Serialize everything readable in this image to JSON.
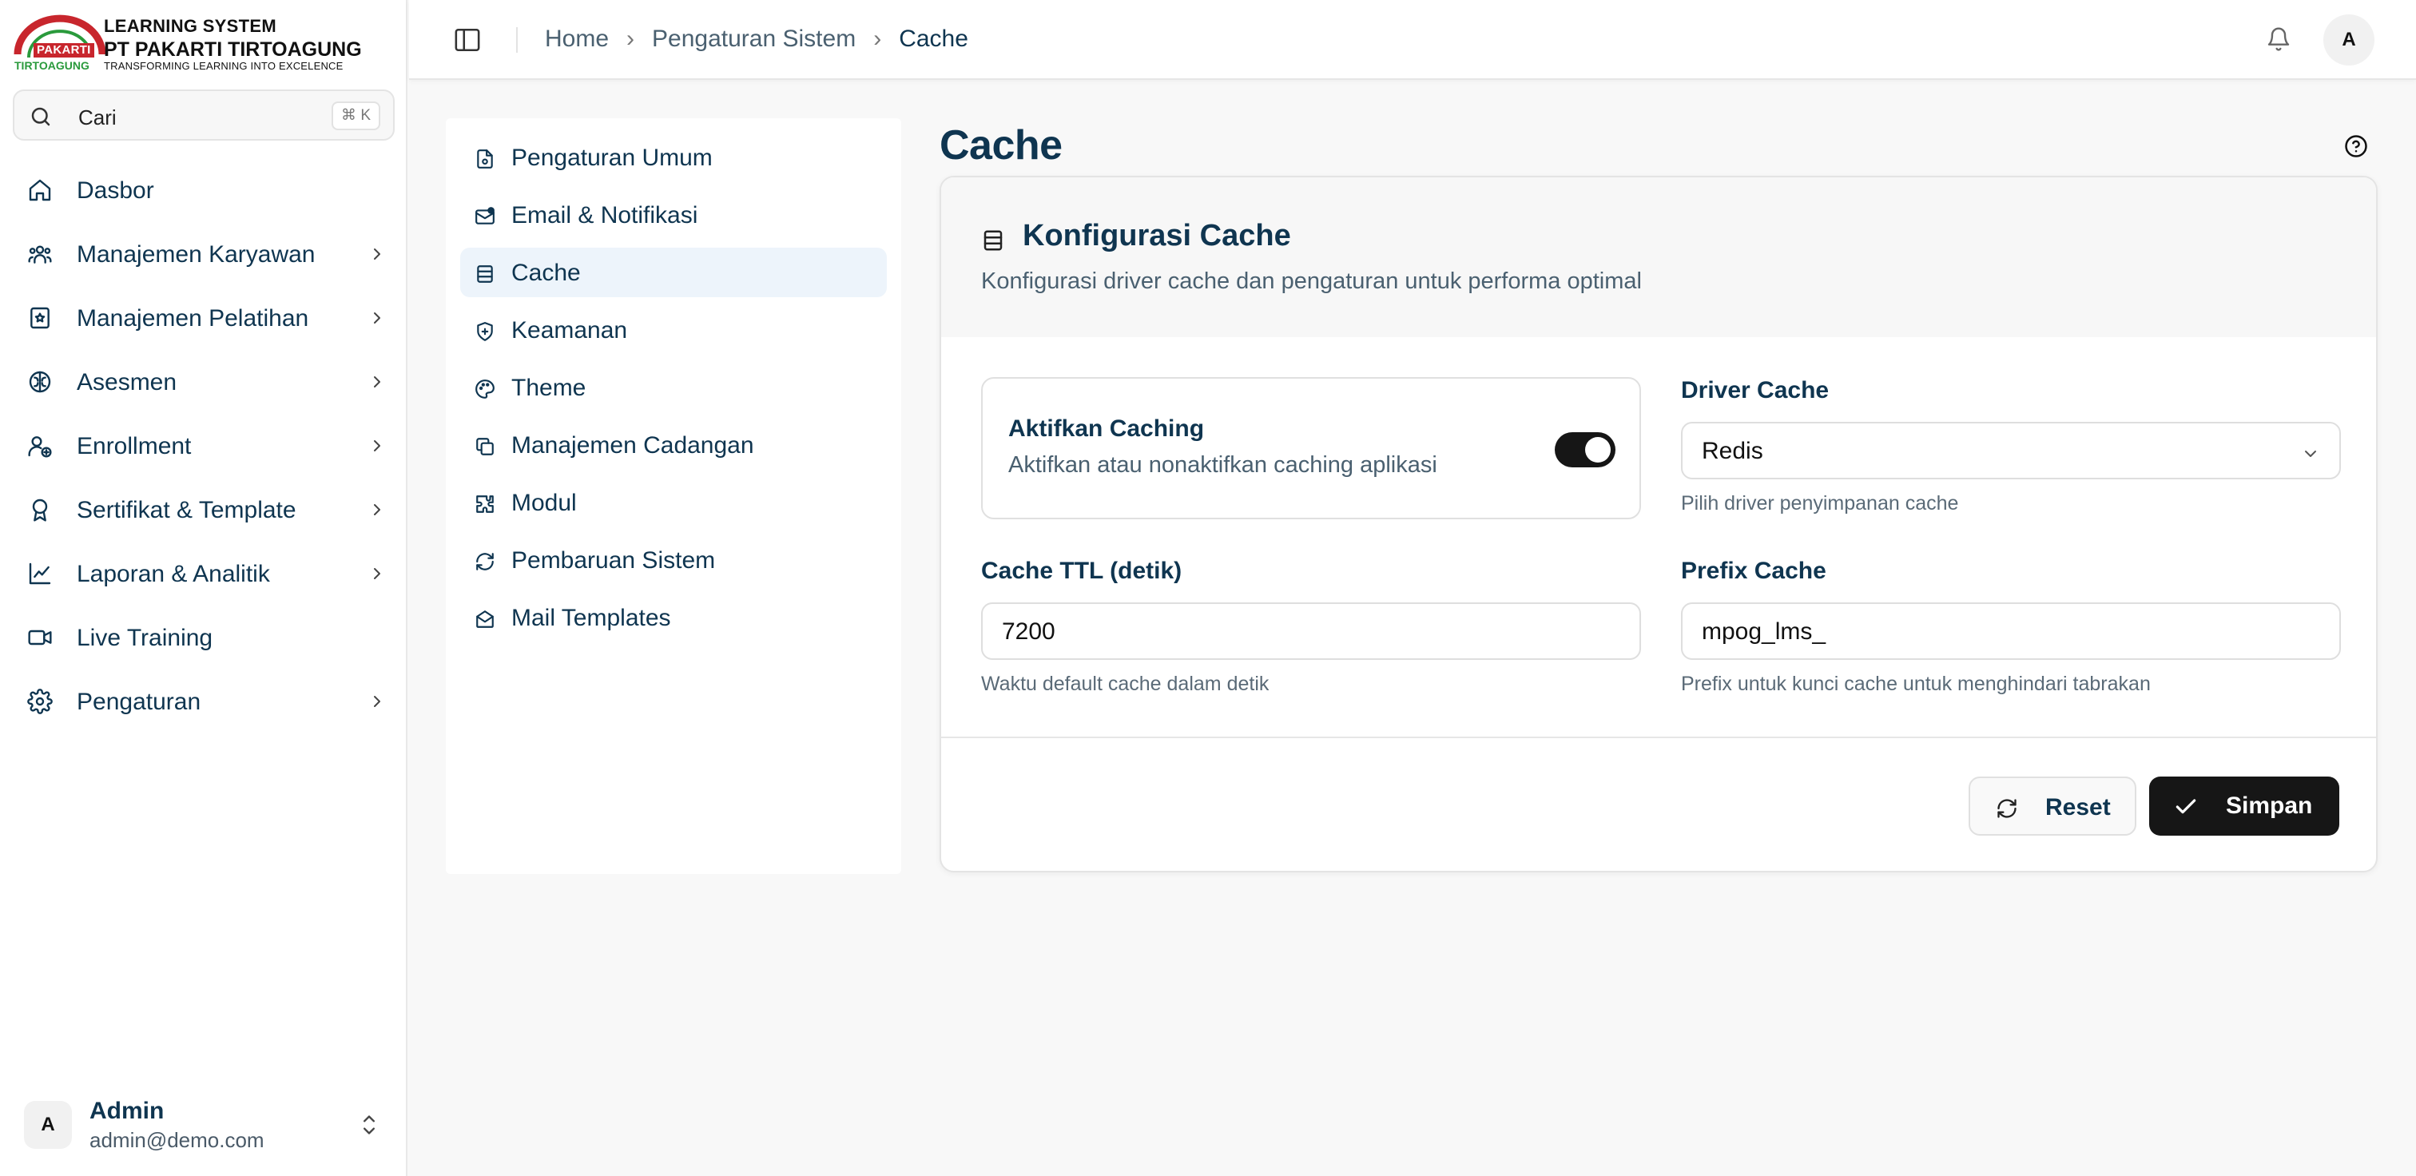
{
  "brand": {
    "logo_text_top": "PAKARTI",
    "logo_text_bottom": "TIRTOAGUNG",
    "line1": "LEARNING SYSTEM",
    "line2": "PT PAKARTI TIRTOAGUNG",
    "line3": "TRANSFORMING LEARNING INTO EXCELENCE",
    "colors": {
      "red": "#c8262d",
      "green": "#2a9a3c"
    }
  },
  "search": {
    "label": "Cari",
    "shortcut": "⌘ K",
    "icon": "search-icon"
  },
  "sidebar": {
    "items": [
      {
        "label": "Dasbor",
        "icon": "home-icon",
        "has_children": false
      },
      {
        "label": "Manajemen Karyawan",
        "icon": "users-icon",
        "has_children": true
      },
      {
        "label": "Manajemen Pelatihan",
        "icon": "book-star-icon",
        "has_children": true
      },
      {
        "label": "Asesmen",
        "icon": "brain-icon",
        "has_children": true
      },
      {
        "label": "Enrollment",
        "icon": "user-plus-icon",
        "has_children": true
      },
      {
        "label": "Sertifikat & Template",
        "icon": "award-icon",
        "has_children": true
      },
      {
        "label": "Laporan & Analitik",
        "icon": "chart-line-icon",
        "has_children": true
      },
      {
        "label": "Live Training",
        "icon": "video-icon",
        "has_children": false
      },
      {
        "label": "Pengaturan",
        "icon": "gear-icon",
        "has_children": true
      }
    ]
  },
  "user": {
    "initial": "A",
    "name": "Admin",
    "email": "admin@demo.com"
  },
  "header": {
    "breadcrumb": [
      "Home",
      "Pengaturan Sistem",
      "Cache"
    ],
    "avatar_initial": "A"
  },
  "settings_nav": {
    "active": "Cache",
    "items": [
      {
        "label": "Pengaturan Umum",
        "icon": "file-settings-icon"
      },
      {
        "label": "Email & Notifikasi",
        "icon": "mail-notification-icon"
      },
      {
        "label": "Cache",
        "icon": "database-icon"
      },
      {
        "label": "Keamanan",
        "icon": "shield-plus-icon"
      },
      {
        "label": "Theme",
        "icon": "palette-icon"
      },
      {
        "label": "Manajemen Cadangan",
        "icon": "copy-icon"
      },
      {
        "label": "Modul",
        "icon": "puzzle-icon"
      },
      {
        "label": "Pembaruan Sistem",
        "icon": "refresh-icon"
      },
      {
        "label": "Mail Templates",
        "icon": "mail-open-icon"
      }
    ]
  },
  "page": {
    "title": "Cache"
  },
  "card": {
    "title": "Konfigurasi Cache",
    "description": "Konfigurasi driver cache dan pengaturan untuk performa optimal",
    "toggle": {
      "title": "Aktifkan Caching",
      "description": "Aktifkan atau nonaktifkan caching aplikasi",
      "enabled": true
    },
    "driver": {
      "label": "Driver Cache",
      "value": "Redis",
      "hint": "Pilih driver penyimpanan cache"
    },
    "ttl": {
      "label": "Cache TTL (detik)",
      "value": "7200",
      "hint": "Waktu default cache dalam detik"
    },
    "prefix": {
      "label": "Prefix Cache",
      "value": "mpog_lms_",
      "hint": "Prefix untuk kunci cache untuk menghindari tabrakan"
    },
    "reset_label": "Reset",
    "save_label": "Simpan"
  },
  "colors": {
    "text": "#0f3550",
    "primary_button": "#161616",
    "active_nav": "#edf4fb"
  }
}
